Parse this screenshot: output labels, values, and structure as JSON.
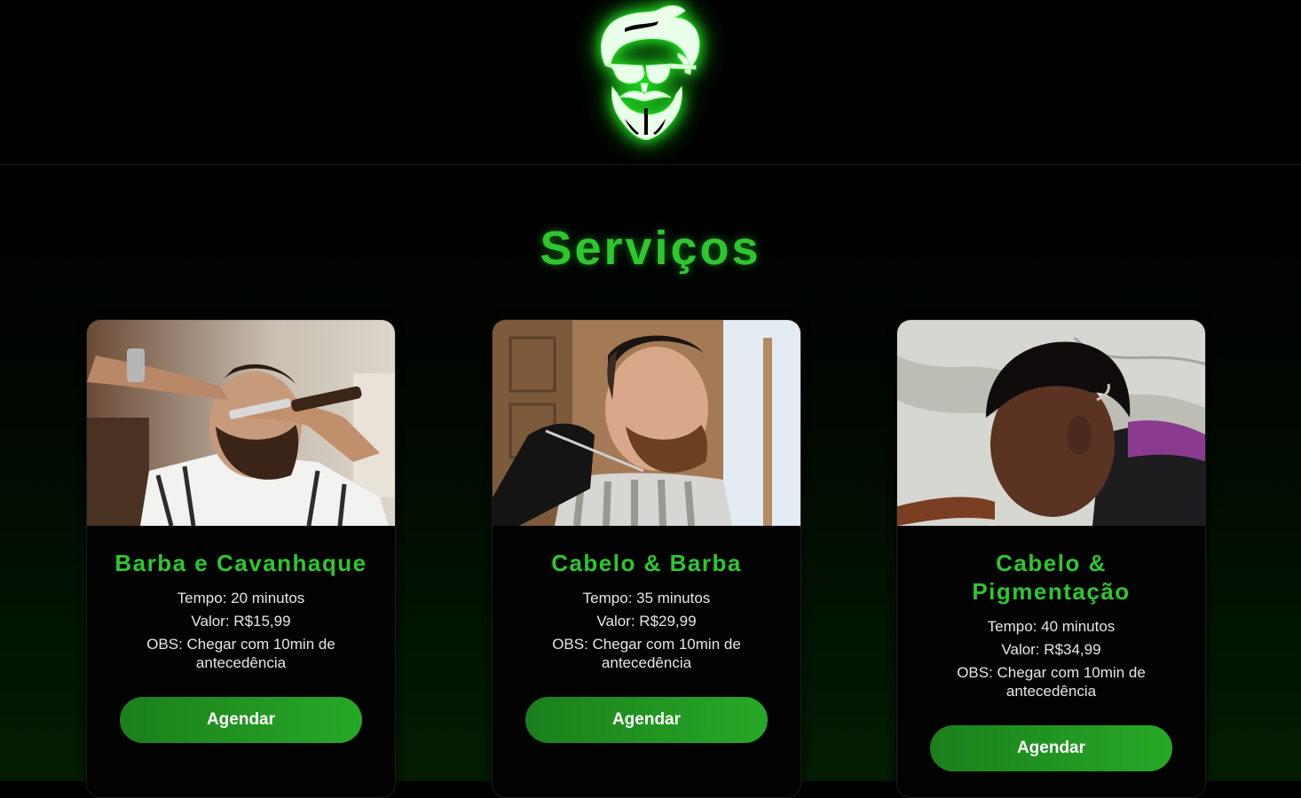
{
  "header": {
    "logo_icon": "bearded-man-sunglasses-logo"
  },
  "section": {
    "title": "Serviços"
  },
  "services": [
    {
      "title": "Barba e Cavanhaque",
      "tempo": "Tempo: 20 minutos",
      "valor": "Valor: R$15,99",
      "obs": "OBS: Chegar com 10min de antecedência",
      "button": "Agendar"
    },
    {
      "title": "Cabelo & Barba",
      "tempo": "Tempo: 35 minutos",
      "valor": "Valor: R$29,99",
      "obs": "OBS: Chegar com 10min de antecedência",
      "button": "Agendar"
    },
    {
      "title": "Cabelo & Pigmentação",
      "tempo": "Tempo: 40 minutos",
      "valor": "Valor: R$34,99",
      "obs": "OBS: Chegar com 10min de antecedência",
      "button": "Agendar"
    }
  ],
  "colors": {
    "accent": "#2ec72e",
    "button_start": "#1b7f1b",
    "button_end": "#27a827",
    "background": "#000000"
  }
}
